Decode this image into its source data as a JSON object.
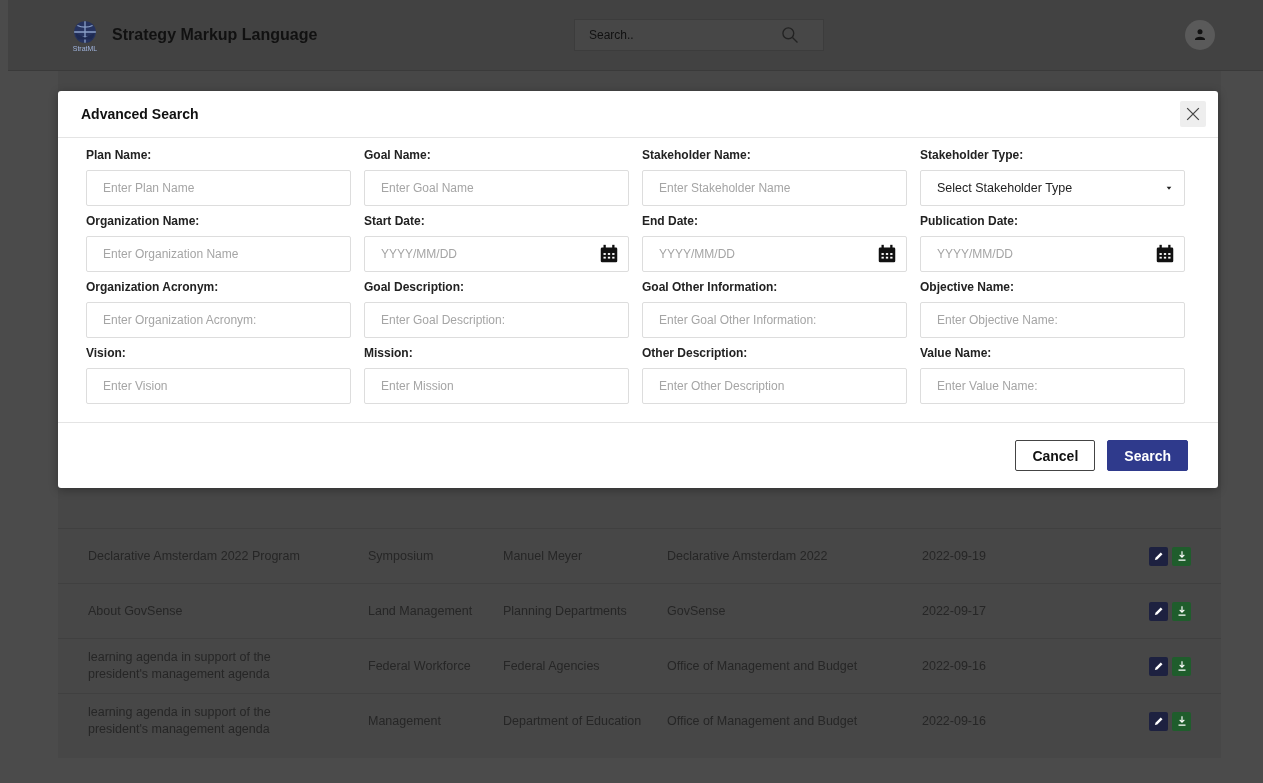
{
  "header": {
    "logo_caption": "StratML",
    "title": "Strategy Markup Language",
    "search": {
      "placeholder": "Search.."
    }
  },
  "table": {
    "rows": [
      {
        "cells": [
          "Declarative Amsterdam 2022 Program",
          "Symposium",
          "Manuel Meyer",
          "Declarative Amsterdam 2022",
          "2022-09-19"
        ]
      },
      {
        "cells": [
          "About GovSense",
          "Land Management",
          "Planning Departments",
          "GovSense",
          "2022-09-17"
        ]
      },
      {
        "cells": [
          "learning agenda in support of the president's management agenda",
          "Federal Workforce",
          "Federal Agencies",
          "Office of Management and Budget",
          "2022-09-16"
        ]
      },
      {
        "cells": [
          "learning agenda in support of the president's management agenda",
          "Management",
          "Department of Education",
          "Office of Management and Budget",
          "2022-09-16"
        ]
      }
    ]
  },
  "dialog": {
    "title": "Advanced Search",
    "fields": [
      {
        "label": "Plan Name:",
        "kind": "text",
        "placeholder": "Enter Plan Name"
      },
      {
        "label": "Goal Name:",
        "kind": "text",
        "placeholder": "Enter Goal Name"
      },
      {
        "label": "Stakeholder Name:",
        "kind": "text",
        "placeholder": "Enter Stakeholder Name"
      },
      {
        "label": "Stakeholder Type:",
        "kind": "select",
        "value": "Select Stakeholder Type"
      },
      {
        "label": "Organization Name:",
        "kind": "text",
        "placeholder": "Enter Organization Name"
      },
      {
        "label": "Start Date:",
        "kind": "date",
        "placeholder": "YYYY/MM/DD"
      },
      {
        "label": "End Date:",
        "kind": "date",
        "placeholder": "YYYY/MM/DD"
      },
      {
        "label": "Publication Date:",
        "kind": "date",
        "placeholder": "YYYY/MM/DD"
      },
      {
        "label": "Organization Acronym:",
        "kind": "text",
        "placeholder": "Enter Organization Acronym:"
      },
      {
        "label": "Goal Description:",
        "kind": "text",
        "placeholder": "Enter Goal Description:"
      },
      {
        "label": "Goal Other Information:",
        "kind": "text",
        "placeholder": "Enter Goal Other Information:"
      },
      {
        "label": "Objective Name:",
        "kind": "text",
        "placeholder": "Enter Objective Name:"
      },
      {
        "label": "Vision:",
        "kind": "text",
        "placeholder": "Enter Vision"
      },
      {
        "label": "Mission:",
        "kind": "text",
        "placeholder": "Enter Mission"
      },
      {
        "label": "Other Description:",
        "kind": "text",
        "placeholder": "Enter Other Description"
      },
      {
        "label": "Value Name:",
        "kind": "text",
        "placeholder": "Enter Value Name:"
      }
    ],
    "buttons": [
      {
        "label": "Cancel",
        "kind": "secondary"
      },
      {
        "label": "Search",
        "kind": "primary"
      }
    ]
  }
}
